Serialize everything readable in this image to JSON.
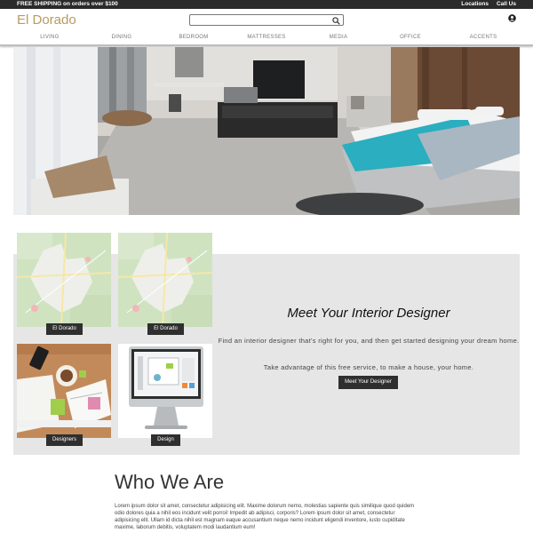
{
  "topbar": {
    "promo": "FREE SHIPPING on orders over $100",
    "links": [
      "Locations",
      "Call Us"
    ]
  },
  "header": {
    "logo": "El Dorado",
    "search_placeholder": "",
    "search_icon": "search-icon",
    "account_icon": "user-circle-icon"
  },
  "nav": [
    "LIVING",
    "DINING",
    "BEDROOM",
    "MATTRESSES",
    "MEDIA",
    "OFFICE",
    "ACCENTS"
  ],
  "tiles": [
    {
      "label": "El Dorado",
      "image": "map-image"
    },
    {
      "label": "El Dorado",
      "image": "map-image"
    },
    {
      "label": "Designers",
      "image": "desk-workspace-photo"
    },
    {
      "label": "Design",
      "image": "computer-monitor-photo"
    }
  ],
  "designer": {
    "title": "Meet Your Interior Designer",
    "paragraph1": "Find an interior designer that's right for you, and then get started designing your dream home.",
    "paragraph2": "Take advantage of this free service, to make a house, your home.",
    "button": "Meet Your Designer"
  },
  "who": {
    "title": "Who We Are",
    "text": "Lorem ipsum dolor sit amet, consectetur adipisicing elit. Maxime dolorum nemo, molestias sapiente quis similique quod quidem odio dolores quia a nihil eos incidunt velit porroi! Impedit ab adipisci, corporis? Lorem ipsum dolor sit amet, consectetur adipisicing elit. Ullam id dicta nihil est magnam eaque accusantium neque nemo incidunt eligendi inventore, iusto cupiditate maxime, laborum debitis, voluptatem modi laudantium eum!"
  },
  "colors": {
    "topbar": "#2b2b2b",
    "logo": "#b89b5e",
    "accent_dark": "#2f2f2f",
    "panel_bg": "#e6e6e6",
    "bed_throw": "#2aaec0"
  }
}
